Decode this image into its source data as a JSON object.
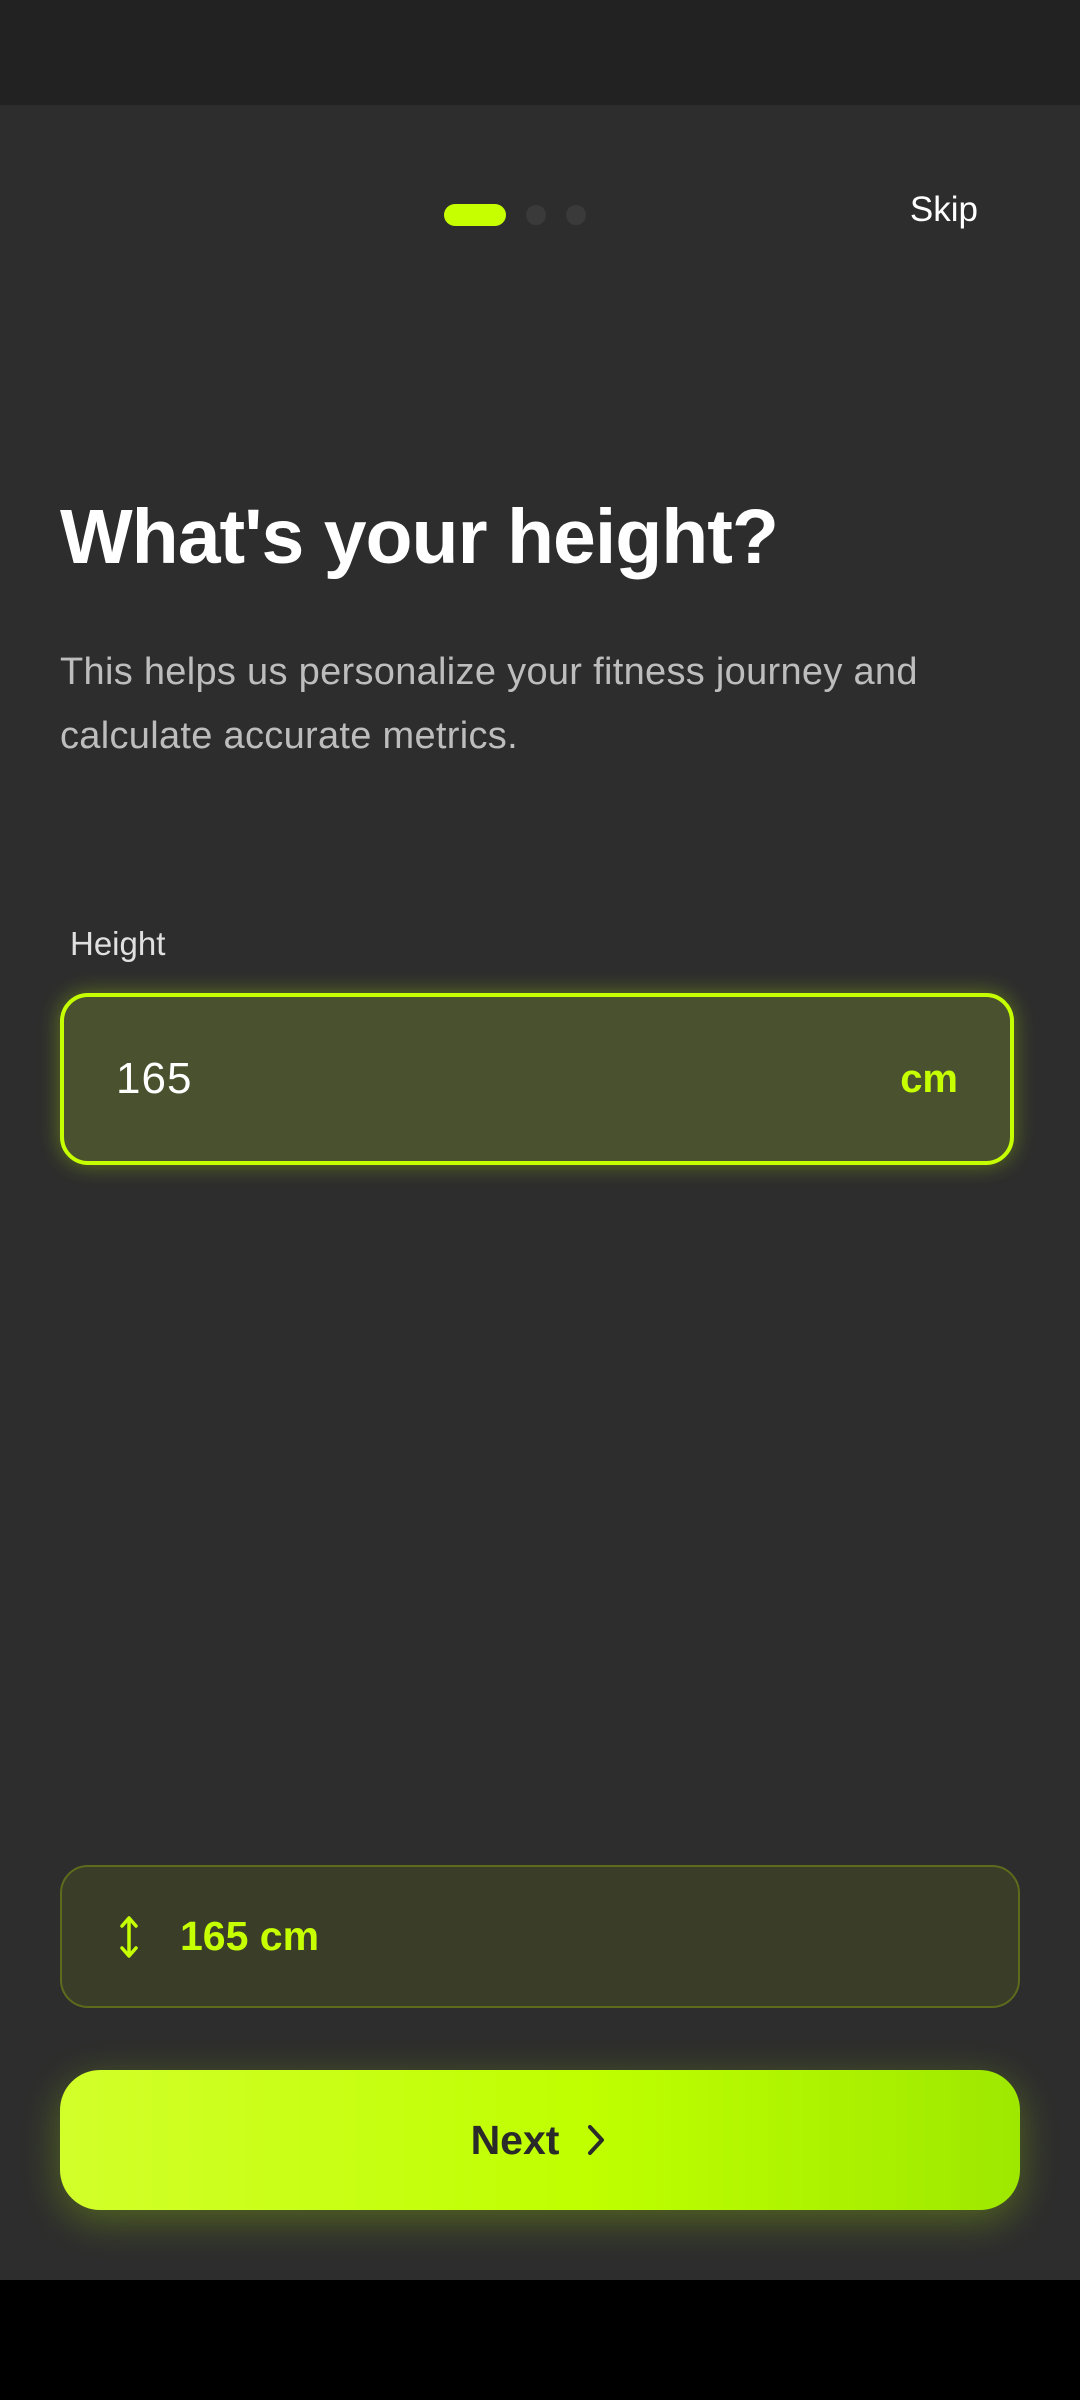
{
  "header": {
    "progress_total": 3,
    "progress_current": 1,
    "skip_label": "Skip"
  },
  "main": {
    "title": "What's your height?",
    "subtitle": "This helps us personalize your fitness journey and calculate accurate metrics.",
    "height_field": {
      "label": "Height",
      "value": "165",
      "unit": "cm"
    },
    "summary": {
      "icon": "vertical-arrows-icon",
      "value": "165 cm"
    }
  },
  "footer": {
    "next_label": "Next",
    "next_icon": "chevron-right-icon"
  },
  "colors": {
    "accent": "#c6ff00",
    "background": "#2d2d2d",
    "status_bar": "#222222",
    "nav_bar": "#000000"
  }
}
